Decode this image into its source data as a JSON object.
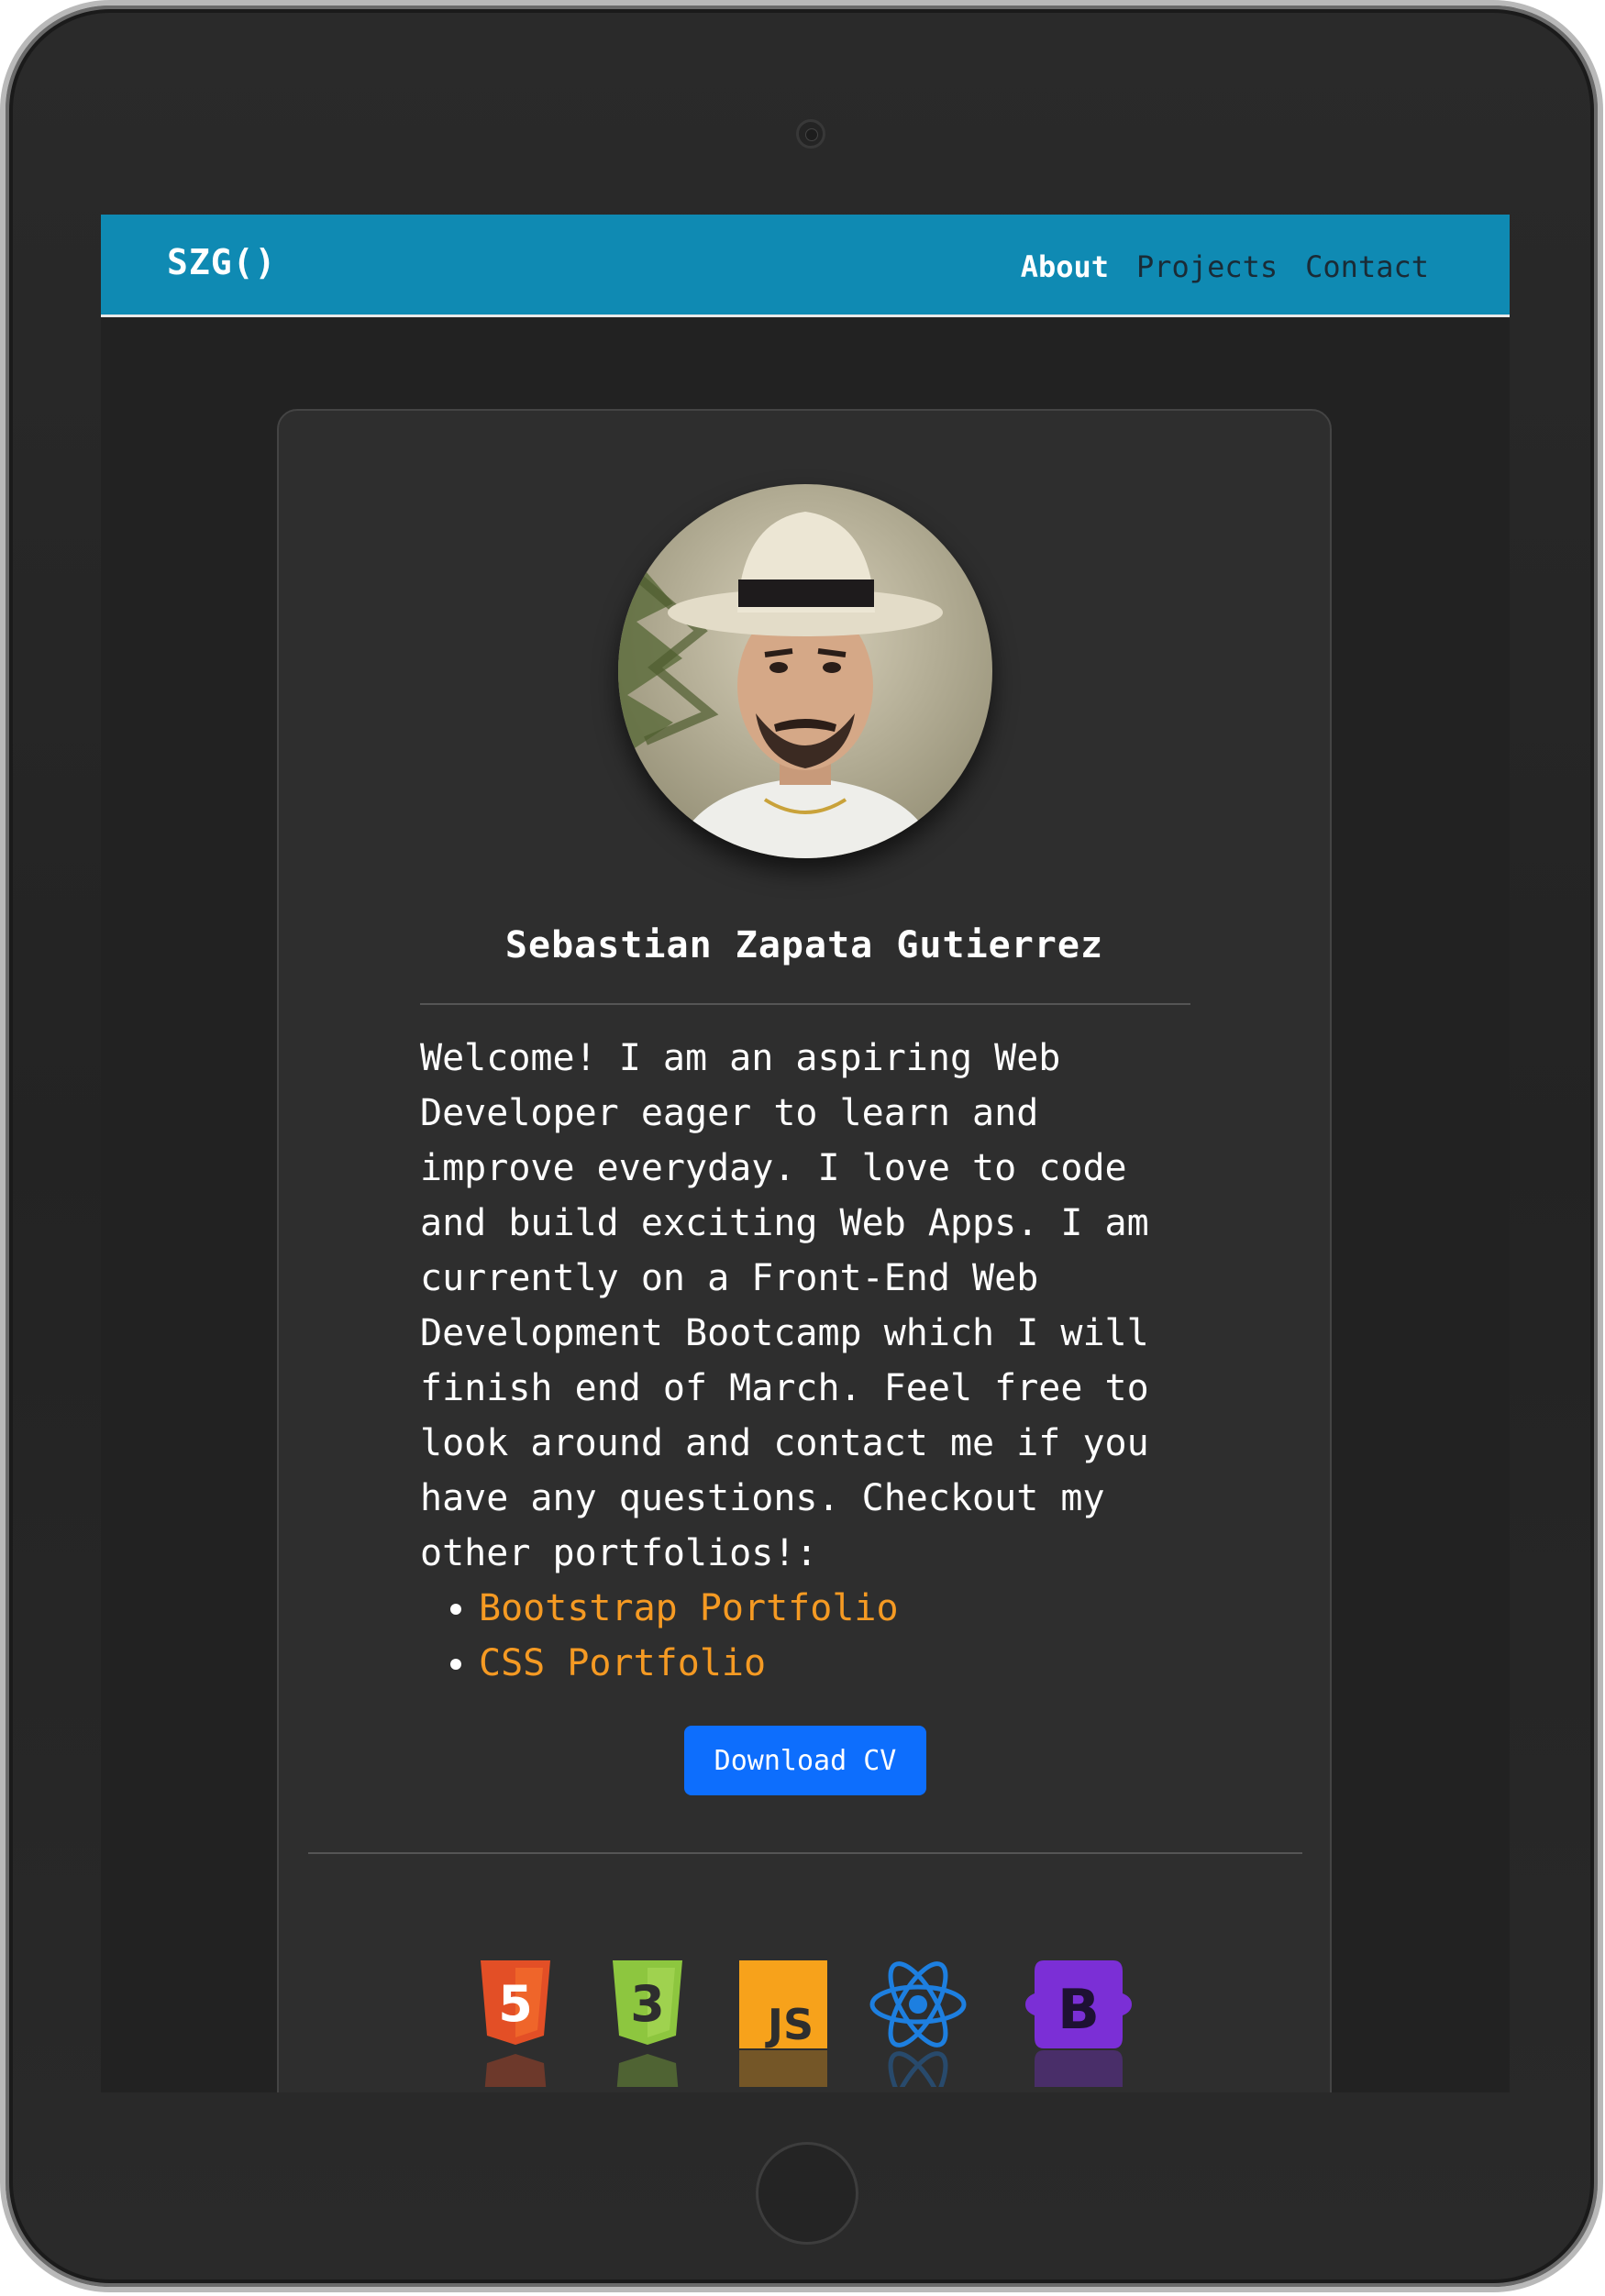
{
  "navbar": {
    "brand": "SZG()",
    "links": [
      {
        "label": "About",
        "active": true
      },
      {
        "label": "Projects",
        "active": false
      },
      {
        "label": "Contact",
        "active": false
      }
    ],
    "background": "#0f8ab3"
  },
  "profile": {
    "name": "Sebastian Zapata Gutierrez",
    "bio_lines": [
      "Welcome! I am an aspiring Web",
      "Developer eager to learn and",
      "improve everyday. I love to code",
      "and build exciting Web Apps. I am",
      "currently on a Front-End Web",
      "Development Bootcamp which I will",
      "finish end of March. Feel free to",
      "look around and contact me if you",
      "have any questions. Checkout my",
      "other portfolios!:"
    ],
    "portfolios": [
      "Bootstrap Portfolio",
      "CSS Portfolio"
    ],
    "cv_button": "Download CV"
  },
  "tech_icons": [
    {
      "icon": "html5-icon",
      "color": "#e34f26",
      "label": "5"
    },
    {
      "icon": "css3-icon",
      "color": "#8dc63f",
      "label": "3"
    },
    {
      "icon": "javascript-icon",
      "color": "#f7a21b",
      "label": "JS"
    },
    {
      "icon": "react-icon",
      "color": "#1d7fe0"
    },
    {
      "icon": "bootstrap-icon",
      "color": "#7b2fd6",
      "label": "B"
    }
  ],
  "colors": {
    "link": "#f59a23",
    "button": "#0d6efd",
    "card": "#2e2e2e",
    "screen": "#222222"
  }
}
